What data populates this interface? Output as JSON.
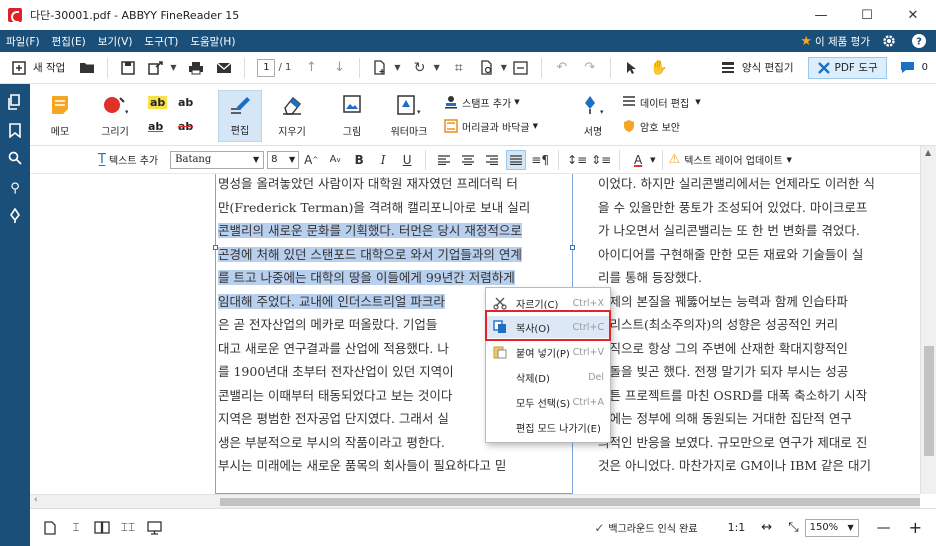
{
  "window": {
    "title": "다단-30001.pdf - ABBYY FineReader 15",
    "minimize": "—",
    "maximize": "☐",
    "close": "✕"
  },
  "menu": {
    "items": [
      "파일(F)",
      "편집(E)",
      "보기(V)",
      "도구(T)",
      "도움말(H)"
    ],
    "rate_label": "이 제품 평가"
  },
  "toolbar": {
    "new_task": "새 작업",
    "page_current": "1",
    "page_total": "/ 1",
    "form_editor": "양식 편집기",
    "pdf_tools": "PDF 도구",
    "comments_count": "0"
  },
  "ribbon": {
    "memo": "메모",
    "draw": "그리기",
    "edit": "편집",
    "erase": "지우기",
    "image": "그림",
    "watermark": "워터마크",
    "stamp_add": "스탬프 추가",
    "header_footer": "머리글과 바닥글",
    "sign": "서명",
    "data_edit": "데이터 편집",
    "password": "암호 보안"
  },
  "format": {
    "add_text": "텍스트 추가",
    "font": "Batang",
    "size": "8",
    "update_layer": "텍스트 레이어 업데이트"
  },
  "doc": {
    "left_lines": [
      "명성을 올려놓았던 사람이자 대학원 재자였던 프레더릭 터",
      "만(Frederick Terman)을 격려해 캘리포니아로 보내 실리",
      "콘밸리의 새로운 문화를 기획했다. 터먼은 당시 재정적으로",
      "곤경에 처해 있던 스탠포드 대학으로 와서 기업들과의 연계",
      "를 트고 나중에는 대학의 땅을 이들에게 99년간 저렴하게",
      "임대해 주었다. 교내에 인더스트리얼 파크라",
      "은 곧 전자산업의 메카로 떠올랐다. 기업들",
      "대고 새로운 연구결과를 산업에 적용했다. 나",
      "를 1900년대 초부터 전자산업이 있던 지역이",
      "콘밸리는 이때부터 태동되었다고 보는 것이다",
      "지역은 평범한 전자공업 단지였다. 그래서 실",
      "생은 부분적으로 부시의 작품이라고 평한다.",
      "  부시는 미래에는 새로운 품목의 회사들이 필요하다고 믿"
    ],
    "right_lines": [
      "이었다. 하지만 실리콘밸리에서는 언제라도 이러한 식",
      "을 수 있을만한 풍토가 조성되어 있었다. 마이크로프",
      "가 나오면서 실리콘밸리는 또 한 번 변화를 겪었다.",
      "아이디어를 구현해줄 만한 모든 재료와 기술들이 실",
      "리를 통해 등장했다.",
      "문제의 본질을 꿰뚫어보는 능력과 함께 인습타파",
      "멀리스트(최소주의자)의 성향은 성공적인 커리",
      "조직으로 항상 그의 주변에 산재한 확대지향적인",
      "충돌을 빚곤 했다. 전쟁 말기가 되자 부시는 성공",
      "해튼 프로젝트를 마친 OSRD를 대폭 축소하기 시작",
      "후에는 정부에 의해 동원되는 거대한 집단적 연구",
      "의적인 반응을 보였다. 규모만으로 연구가 제대로 진",
      "것은 아니었다. 마찬가지로 GM이나 IBM 같은 대기"
    ]
  },
  "context_menu": {
    "items": [
      {
        "label": "자르기(C)",
        "shortcut": "Ctrl+X"
      },
      {
        "label": "복사(O)",
        "shortcut": "Ctrl+C"
      },
      {
        "label": "붙여 넣기(P)",
        "shortcut": "Ctrl+V"
      },
      {
        "label": "삭제(D)",
        "shortcut": "Del"
      },
      {
        "label": "모두 선택(S)",
        "shortcut": "Ctrl+A"
      },
      {
        "label": "편집 모드 나가기(E)",
        "shortcut": ""
      }
    ]
  },
  "status": {
    "background_ocr": "백그라운드 인식 완료",
    "ratio": "1:1",
    "zoom": "150%"
  },
  "colors": {
    "brand_blue": "#1a4f7a",
    "selection": "#b9cfee",
    "highlight_red": "#e1252c"
  }
}
